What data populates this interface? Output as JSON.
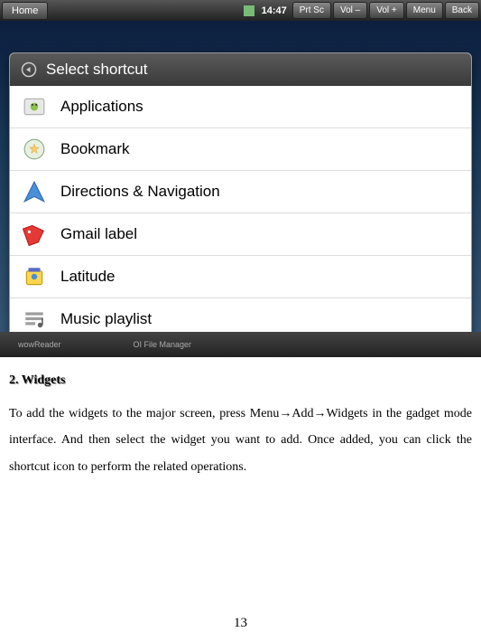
{
  "statusbar": {
    "home": "Home",
    "time": "14:47",
    "buttons": [
      "Prt Sc",
      "Vol –",
      "Vol +",
      "Menu",
      "Back"
    ]
  },
  "dialog": {
    "title": "Select shortcut",
    "items": [
      {
        "label": "Applications"
      },
      {
        "label": "Bookmark"
      },
      {
        "label": "Directions & Navigation"
      },
      {
        "label": "Gmail label"
      },
      {
        "label": "Latitude"
      },
      {
        "label": "Music playlist"
      }
    ]
  },
  "dock": {
    "left": "wowReader",
    "right": "OI File Manager"
  },
  "doc": {
    "section_title": "2. Widgets",
    "body": "To add the widgets to the major screen, press Menu→Add→Widgets in the gadget mode interface. And then select the widget you want to add. Once added, you can click the shortcut icon to perform the related operations.",
    "page_number": "13"
  }
}
